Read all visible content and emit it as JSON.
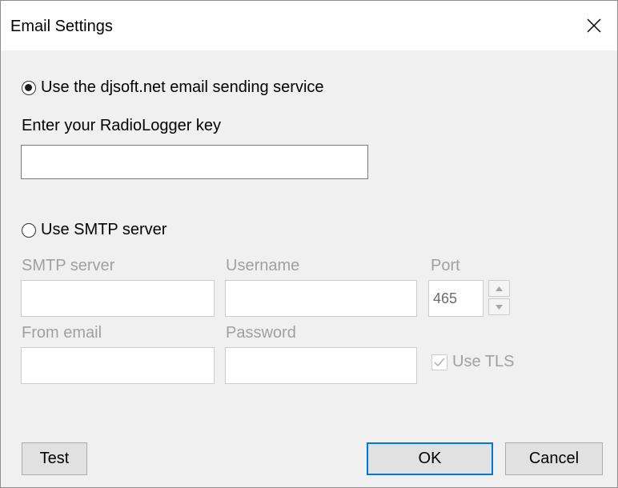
{
  "window": {
    "title": "Email Settings"
  },
  "djsoft_option": {
    "label": "Use the djsoft.net email sending service",
    "selected": true,
    "key_label": "Enter your RadioLogger key",
    "key_value": ""
  },
  "smtp_option": {
    "label": "Use SMTP server",
    "selected": false,
    "server_label": "SMTP server",
    "server_value": "",
    "username_label": "Username",
    "username_value": "",
    "port_label": "Port",
    "port_value": "465",
    "from_label": "From email",
    "from_value": "",
    "password_label": "Password",
    "password_value": "",
    "use_tls_label": "Use TLS",
    "use_tls_checked": true
  },
  "buttons": {
    "test": "Test",
    "ok": "OK",
    "cancel": "Cancel"
  },
  "colors": {
    "default_button_border": "#0078d7",
    "disabled_text": "#a0a0a0"
  }
}
